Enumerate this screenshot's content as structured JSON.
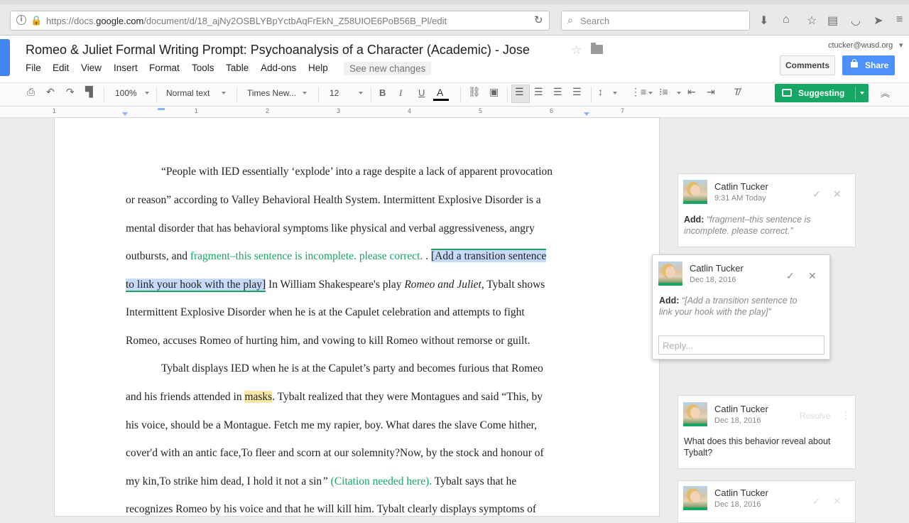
{
  "browser": {
    "url_prefix": "https://docs.",
    "url_host": "google.com",
    "url_path": "/document/d/18_ajNy2OSBLYBpYctbAqFrEkN_Z58UIOE6PoB56B_Pl/edit",
    "search_placeholder": "Search"
  },
  "doc": {
    "title": "Romeo & Juliet Formal Writing Prompt: Psychoanalysis of a Character (Academic) - Jose",
    "user_email": "ctucker@wusd.org",
    "comments_label": "Comments",
    "share_label": "Share",
    "see_new_changes": "See new changes",
    "menu": [
      "File",
      "Edit",
      "View",
      "Insert",
      "Format",
      "Tools",
      "Table",
      "Add-ons",
      "Help"
    ]
  },
  "toolbar": {
    "zoom": "100%",
    "style": "Normal text",
    "font": "Times New...",
    "size": "12",
    "bold": "B",
    "italic": "I",
    "underline": "U",
    "text_color": "A",
    "mode": "Suggesting"
  },
  "ruler": [
    "1",
    "1",
    "2",
    "3",
    "4",
    "5",
    "6",
    "7"
  ],
  "body": {
    "l1": "“People with IED essentially ‘explode’ into a rage despite a lack of apparent provocation",
    "l2": "or reason” according to Valley Behavioral Health System. Intermittent Explosive Disorder is a",
    "l3": "mental disorder that has behavioral symptoms like physical and verbal aggressiveness, angry",
    "l4_a": "outbursts, and ",
    "l4_sug": "fragment–this sentence is incomplete. please correct.",
    "l4_b": "  . ",
    "l4_sel": "[Add a transition sentence",
    "l5_sel": "to link your hook with the play]",
    "l5_b": " In William Shakespeare's play ",
    "l5_ital": "Romeo and Juliet",
    "l5_c": ", Tybalt shows",
    "l6": "Intermittent Explosive Disorder when he is at the Capulet celebration and attempts to fight",
    "l7": "Romeo, accuses Romeo of hurting him, and vowing to  kill Romeo without  remorse or guilt.",
    "l8": "Tybalt displays IED when he is at the Capulet’s party and becomes  furious that Romeo",
    "l9_a": "and his friends attended in ",
    "l9_hl": "masks",
    "l9_b": ". Tybalt realized that they were Montagues and said “This, by",
    "l10": "his voice, should be a Montague. Fetch me my rapier, boy. What dares the slave Come hither,",
    "l11": "cover'd with an antic face,To fleer and scorn at our solemnity?Now, by the stock and honour of",
    "l12_a": "my kin,To strike him dead, I hold it not a sin",
    "l12_q": "” ",
    "l12_sug": "(Citation needed here).",
    "l12_b": "  Tybalt says that he",
    "l13": "recognizes Romeo by his voice and that he will kill him. Tybalt clearly displays symptoms of"
  },
  "comments": [
    {
      "author": "Catlin Tucker",
      "date": "9:31 AM Today",
      "label": "Add:",
      "text": "“fragment–this sentence is",
      "text2": "incomplete. please correct.”"
    },
    {
      "author": "Catlin Tucker",
      "date": "Dec 18, 2016",
      "label": "Add:",
      "text": "“[Add a transition sentence to",
      "text2": "link your hook with the play]”",
      "reply_placeholder": "Reply..."
    },
    {
      "author": "Catlin Tucker",
      "date": "Dec 18, 2016",
      "resolve": "Resolve",
      "text": "What does this behavior reveal about",
      "text2": "Tybalt?"
    },
    {
      "author": "Catlin Tucker",
      "date": "Dec 18, 2016"
    }
  ],
  "colors": {
    "suggestion": "#16a765",
    "selection": "#c6dafc",
    "highlight": "#fce8a6",
    "share": "#4d90fe"
  }
}
